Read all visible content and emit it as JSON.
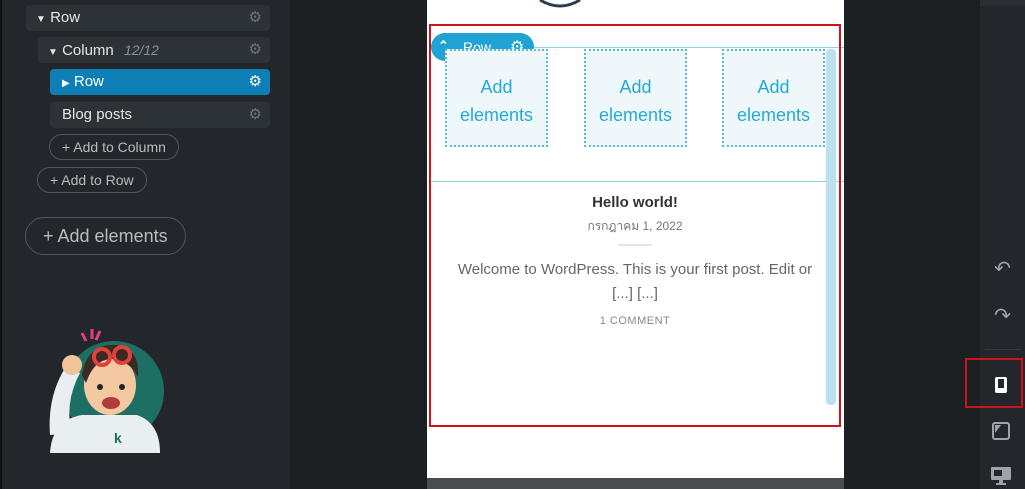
{
  "layers": {
    "items": [
      {
        "label": "Row"
      },
      {
        "label": "Column",
        "meta": "12/12"
      },
      {
        "label": "Row"
      },
      {
        "label": "Blog posts"
      }
    ],
    "add_to_column": "+ Add to Column",
    "add_to_row": "+ Add to Row",
    "add_elements": "+ Add elements"
  },
  "canvas": {
    "row_badge": "Row",
    "add_box_label": "Add elements",
    "post": {
      "title": "Hello world!",
      "date": "กรกฎาคม 1, 2022",
      "excerpt": "Welcome to WordPress. This is your first post. Edit or [...] [...]",
      "comments": "1 COMMENT"
    }
  },
  "toolbar": {
    "icons": [
      "undo-icon",
      "redo-icon",
      "mobile-view-icon",
      "tablet-view-icon",
      "desktop-view-icon"
    ],
    "active": "mobile-view-icon"
  },
  "colors": {
    "accent": "#1ea3d4",
    "highlight": "#d0121b",
    "active_item": "#0e7fb4"
  }
}
